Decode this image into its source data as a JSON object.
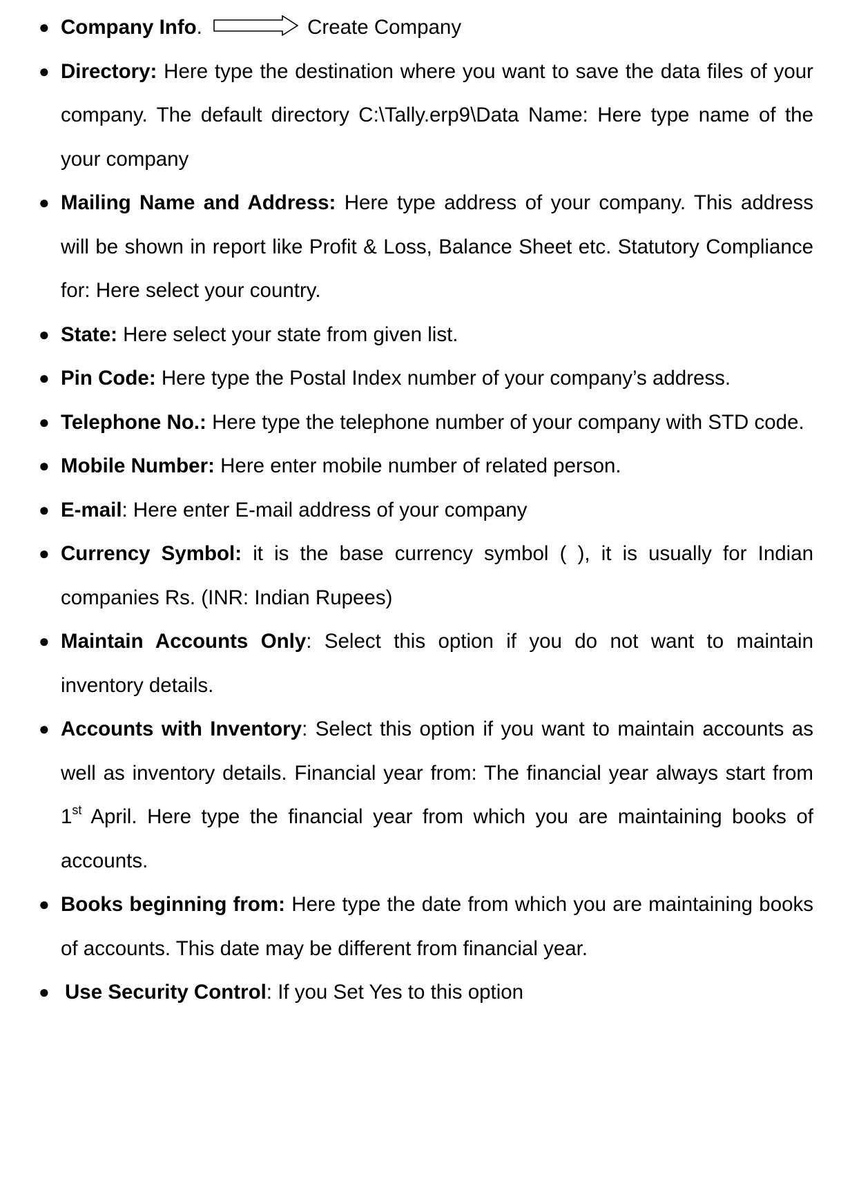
{
  "items": [
    {
      "term": "Company Info",
      "sep": ".",
      "after_arrow": "Create Company"
    },
    {
      "term": "Directory:",
      "text": " Here type the destination where you want to save the data files of your company. The default directory C:\\Tally.erp9\\Data Name: Here type name of the your company"
    },
    {
      "term": "Mailing Name and Address:",
      "text": " Here type address of your company. This address will be shown in report like Profit & Loss, Balance Sheet etc. Statutory Compliance for: Here select your country."
    },
    {
      "term": "State:",
      "text": " Here select your state from given list."
    },
    {
      "term": "Pin Code:",
      "text": " Here type the Postal Index number of your company’s address."
    },
    {
      "term": "Telephone No.:",
      "text": " Here type the telephone number of your company with STD code."
    },
    {
      "term": "Mobile Number:",
      "text": " Here enter mobile number of related person."
    },
    {
      "term": "E-mail",
      "text": ": Here enter E-mail address of your company"
    },
    {
      "term": "Currency Symbol:",
      "text": " it is the base currency symbol ( ), it is usually for Indian companies Rs. (INR: Indian Rupees)"
    },
    {
      "term": "Maintain Accounts Only",
      "text": ": Select this option if you do not want to maintain inventory details."
    },
    {
      "term": "Accounts with Inventory",
      "text_a": ": Select this option if you want to maintain accounts as well as inventory details. Financial year from: The financial year always start from 1",
      "sup": "st",
      "text_b": " April. Here type the financial year from which you are maintaining books of accounts."
    },
    {
      "term": "Books beginning from:",
      "text": " Here type the date from which you are maintaining books of accounts. This date may be different from financial year."
    },
    {
      "term": "Use Security Control",
      "text": ": If you Set Yes to this option"
    }
  ],
  "icons": {
    "bullet": "bullet-dot-icon",
    "arrow": "right-arrow-icon"
  }
}
